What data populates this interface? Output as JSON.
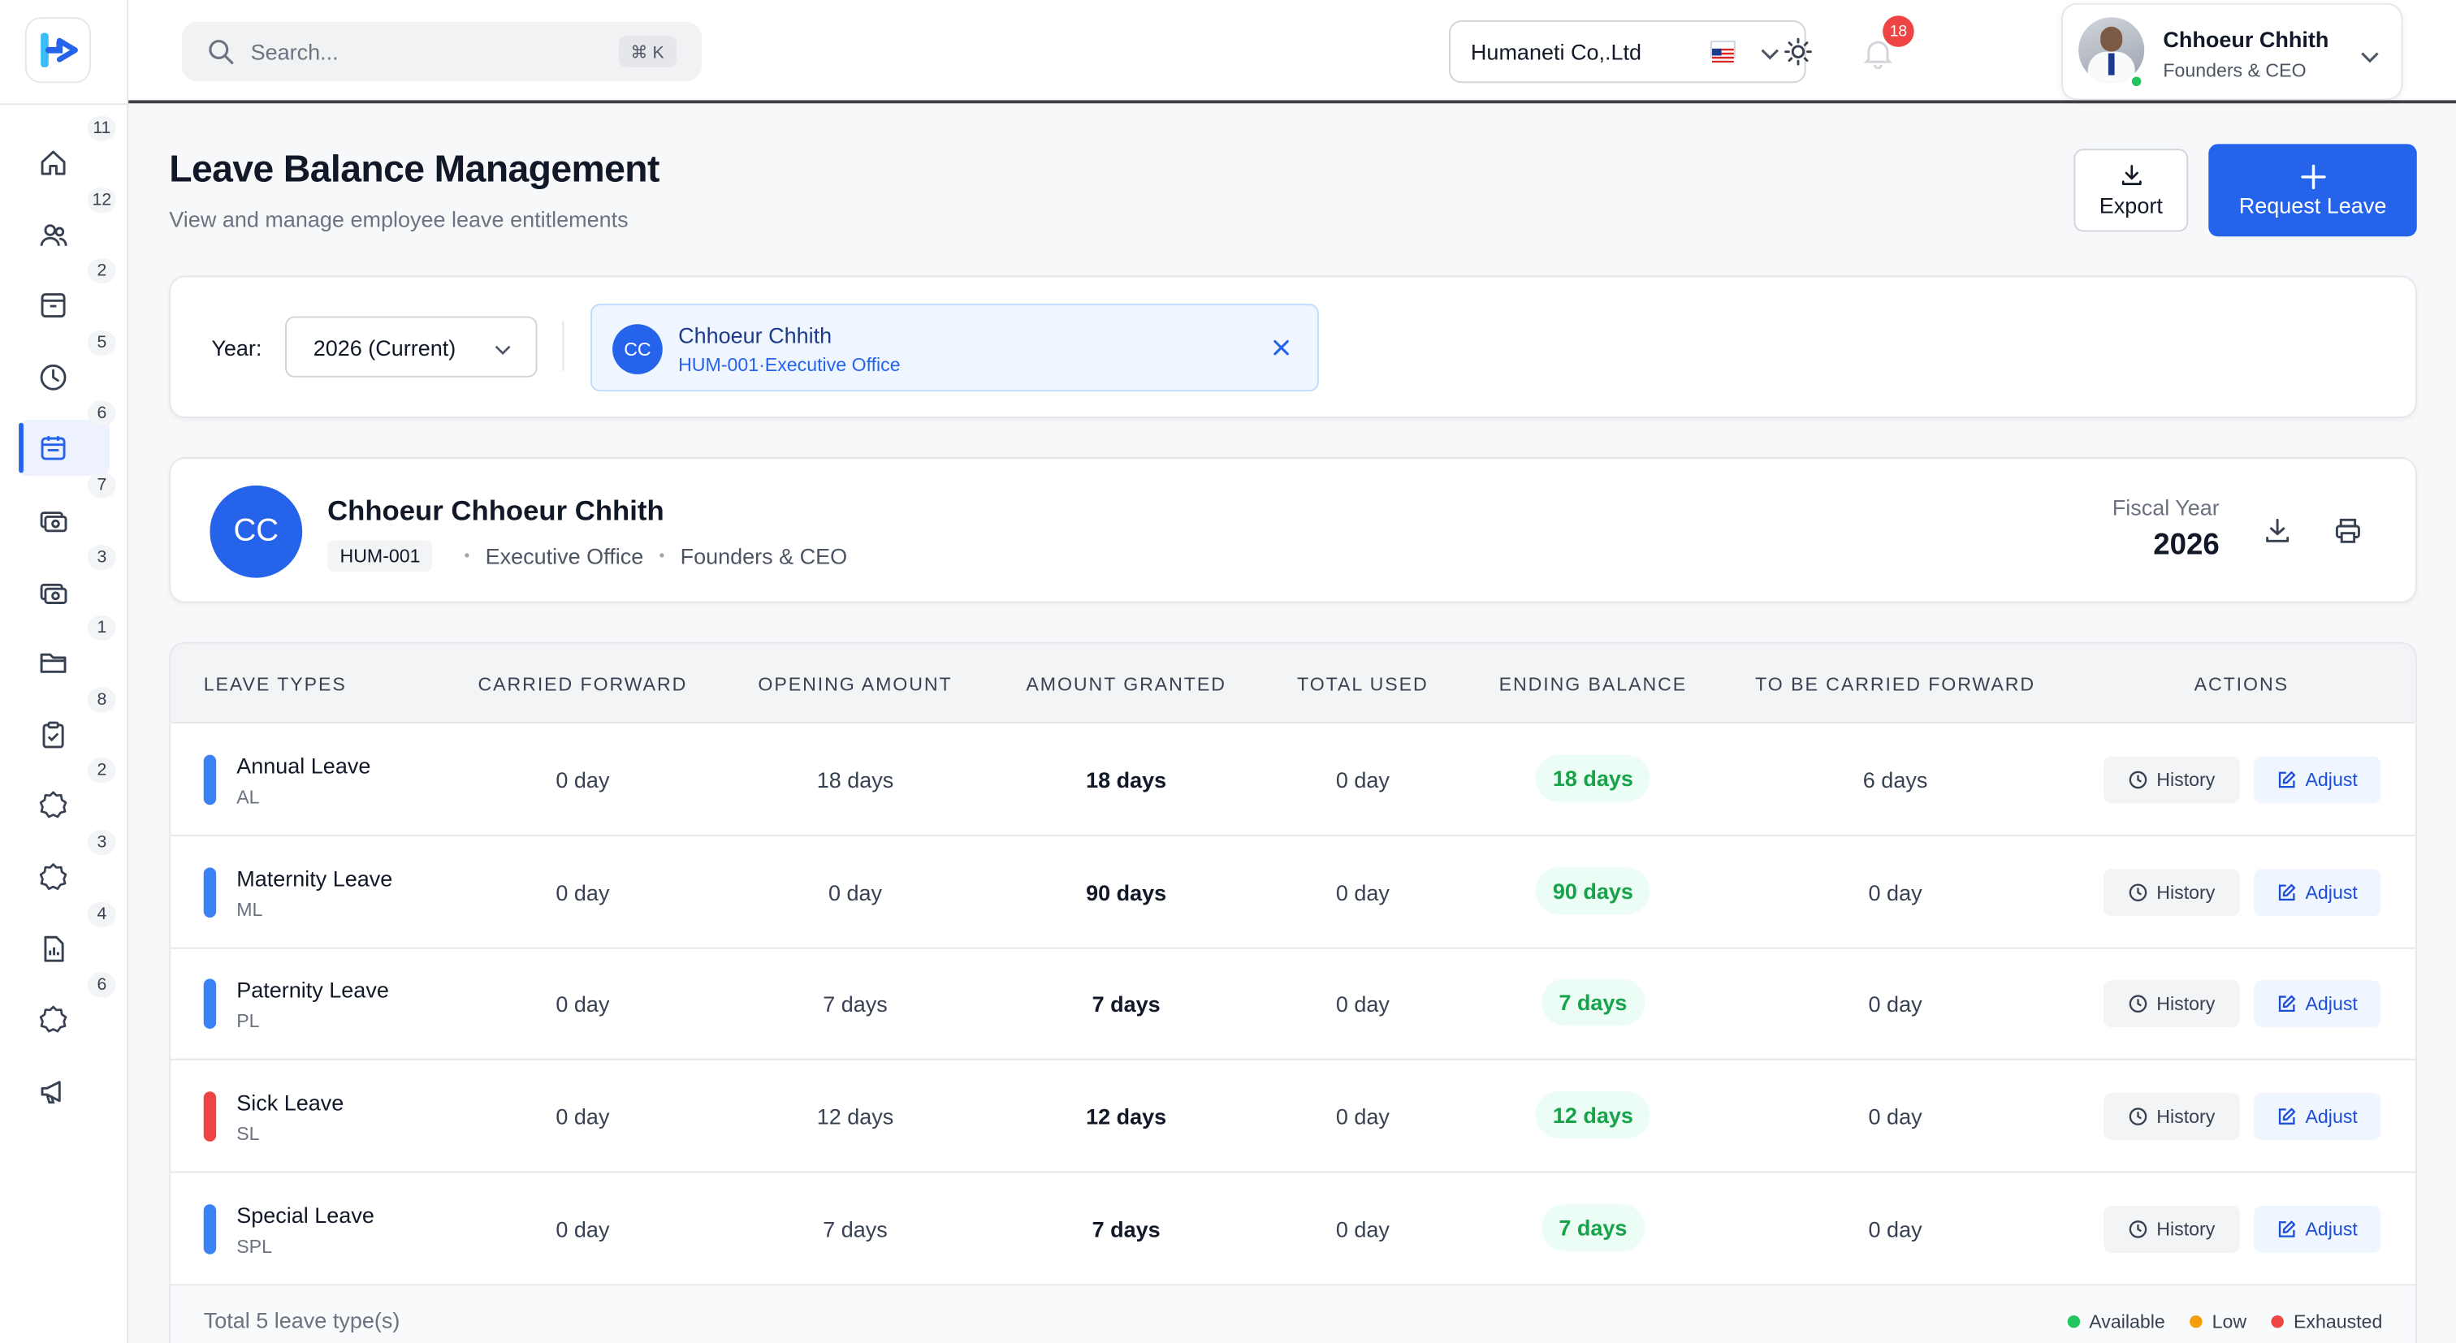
{
  "search": {
    "placeholder": "Search...",
    "shortcut": "⌘ K"
  },
  "topbar": {
    "company": "Humaneti Co,.Ltd",
    "notifications": "18",
    "user": {
      "name": "Chhoeur Chhith",
      "role": "Founders & CEO"
    }
  },
  "sidebar": {
    "items": [
      {
        "icon": "home-icon",
        "badge": "11"
      },
      {
        "icon": "users-icon",
        "badge": "12"
      },
      {
        "icon": "archive-icon",
        "badge": "2"
      },
      {
        "icon": "clock-icon",
        "badge": "5"
      },
      {
        "icon": "calendar-icon",
        "badge": "6",
        "active": true
      },
      {
        "icon": "money-icon",
        "badge": "7"
      },
      {
        "icon": "cash-icon",
        "badge": "3"
      },
      {
        "icon": "folder-icon",
        "badge": "1"
      },
      {
        "icon": "clipboard-icon",
        "badge": "8"
      },
      {
        "icon": "gear-icon",
        "badge": "2"
      },
      {
        "icon": "gear-icon",
        "badge": "3"
      },
      {
        "icon": "report-icon",
        "badge": "4"
      },
      {
        "icon": "gear-icon",
        "badge": "6"
      },
      {
        "icon": "megaphone-icon",
        "badge": ""
      }
    ]
  },
  "page": {
    "title": "Leave Balance Management",
    "subtitle": "View and manage employee leave entitlements",
    "export_label": "Export",
    "request_label": "Request Leave"
  },
  "filters": {
    "year_label": "Year:",
    "year_value": "2026 (Current)",
    "employee": {
      "initials": "CC",
      "name": "Chhoeur Chhith",
      "sub": "HUM-001·Executive Office"
    }
  },
  "employee_card": {
    "initials": "CC",
    "name": "Chhoeur Chhoeur Chhith",
    "code": "HUM-001",
    "department": "Executive Office",
    "position": "Founders & CEO",
    "fiscal_label": "Fiscal Year",
    "fiscal_value": "2026"
  },
  "table": {
    "headers": [
      "LEAVE TYPES",
      "CARRIED FORWARD",
      "OPENING AMOUNT",
      "AMOUNT GRANTED",
      "TOTAL USED",
      "ENDING BALANCE",
      "TO BE CARRIED FORWARD",
      "ACTIONS"
    ],
    "history_label": "History",
    "adjust_label": "Adjust",
    "rows": [
      {
        "name": "Annual Leave",
        "code": "AL",
        "color": "#3b82f6",
        "carried": "0 day",
        "opening": "18 days",
        "granted": "18 days",
        "used": "0 day",
        "ending": "18 days",
        "to_carry": "6 days"
      },
      {
        "name": "Maternity Leave",
        "code": "ML",
        "color": "#3b82f6",
        "carried": "0 day",
        "opening": "0 day",
        "granted": "90 days",
        "used": "0 day",
        "ending": "90 days",
        "to_carry": "0 day"
      },
      {
        "name": "Paternity Leave",
        "code": "PL",
        "color": "#3b82f6",
        "carried": "0 day",
        "opening": "7 days",
        "granted": "7 days",
        "used": "0 day",
        "ending": "7 days",
        "to_carry": "0 day"
      },
      {
        "name": "Sick Leave",
        "code": "SL",
        "color": "#ef4444",
        "carried": "0 day",
        "opening": "12 days",
        "granted": "12 days",
        "used": "0 day",
        "ending": "12 days",
        "to_carry": "0 day"
      },
      {
        "name": "Special Leave",
        "code": "SPL",
        "color": "#3b82f6",
        "carried": "0 day",
        "opening": "7 days",
        "granted": "7 days",
        "used": "0 day",
        "ending": "7 days",
        "to_carry": "0 day"
      }
    ],
    "footer_total": "Total 5 leave type(s)",
    "legend": [
      {
        "label": "Available",
        "color": "#22c55e"
      },
      {
        "label": "Low",
        "color": "#f59e0b"
      },
      {
        "label": "Exhausted",
        "color": "#ef4444"
      }
    ]
  }
}
